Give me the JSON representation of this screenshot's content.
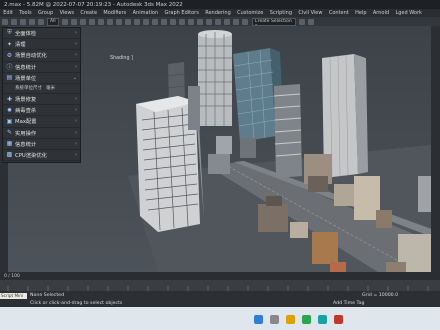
{
  "window": {
    "title": "2.max - 5.82M @ 2022-07-07 20:19:23 - Autodesk 3ds Max 2022"
  },
  "menu": [
    "Edit",
    "Tools",
    "Group",
    "Views",
    "Create",
    "Modifiers",
    "Animation",
    "Graph Editors",
    "Rendering",
    "Customize",
    "Scripting",
    "Civil View",
    "Content",
    "Help",
    "Arnold",
    "Lged Work"
  ],
  "toolbar": {
    "view_dropdown": "All",
    "selection_set": "Create Selection Se"
  },
  "viewport": {
    "label": "Shading ]"
  },
  "panel": {
    "items": [
      {
        "icon": "shield-icon",
        "label": "全面体检",
        "chev": "›"
      },
      {
        "icon": "broom-icon",
        "label": "清理",
        "chev": "›"
      },
      {
        "icon": "settings-icon",
        "label": "场景自动优化",
        "chev": "›"
      },
      {
        "icon": "info-icon",
        "label": "信息统计",
        "chev": "›"
      },
      {
        "icon": "ruler-icon",
        "label": "场景单位",
        "chev": "⌄"
      }
    ],
    "sub_row": {
      "label": "系统单位尺寸",
      "value": "毫米"
    },
    "items2": [
      {
        "icon": "tools-icon",
        "label": "场景修复",
        "chev": "›"
      },
      {
        "icon": "virus-icon",
        "label": "病毒查杀",
        "chev": "›"
      },
      {
        "icon": "max-icon",
        "label": "Max配置",
        "chev": "›"
      },
      {
        "icon": "wrench-icon",
        "label": "实用操作",
        "chev": "›"
      },
      {
        "icon": "stats-icon",
        "label": "信息统计",
        "chev": "›"
      },
      {
        "icon": "cpu-icon",
        "label": "CPU渲染优化",
        "chev": "›"
      }
    ]
  },
  "timeline": {
    "frame": "0 / 100"
  },
  "status": {
    "script_label": "Script Mini",
    "selection": "None Selected",
    "hint": "Click or click-and-drag to select objects",
    "grid": "Grid = 10000.0",
    "add_tag": "Add Time Tag"
  },
  "colors": {
    "accent": "#4aa3ff",
    "panel_bg": "#2f3236",
    "viewport_bg": "#444a50",
    "taskbar": "#dfe6ee"
  }
}
